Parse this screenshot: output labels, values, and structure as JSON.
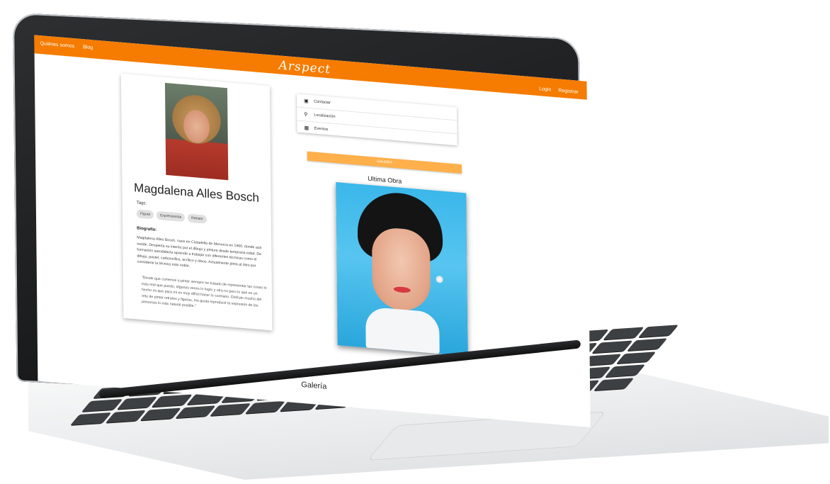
{
  "header": {
    "nav_left": [
      "Quiénes somos",
      "Blog"
    ],
    "logo": "Arspect",
    "nav_right": [
      "Login",
      "Registrar"
    ]
  },
  "profile": {
    "name": "Magdalena Alles Bosch",
    "tags_label": "Tags:",
    "tags": [
      "Figura",
      "Expresionista",
      "Retrato"
    ],
    "bio_title": "Biografía:",
    "bio": "Magdalena Alles Bosch, nace en Ciutadella de Menorca en 1960, donde aún reside. Despierta su interés por el dibujo y pintura desde temprana edad. De formación autodidacta aprende a trabajar con diferentes técnicas como el dibujo, pastel, carboncillos, acrílico y óleos. Actualmente pinta al óleo por considerar la técnica más noble.",
    "quote": "\"Desde que comencé a pintar siempre he tratado de representar las cosas lo más real que puedo, algunas veces lo logro y otra no pero lo que es un hecho es que para mí es muy difícil hacer lo contrario. Disfruto mucho del reto de pintar retratos y figuras, me gusta reproducir la expresión de las personas lo más natural posible.\""
  },
  "info": {
    "rows": [
      {
        "icon": "contact-card-icon",
        "label": "Contactar"
      },
      {
        "icon": "location-pin-icon",
        "label": "Localización"
      },
      {
        "icon": "calendar-icon",
        "label": "Eventos"
      }
    ]
  },
  "gallery": {
    "button_label": "GALERÍA",
    "latest_title": "Ultima Obra",
    "footer_heading": "Galería"
  }
}
